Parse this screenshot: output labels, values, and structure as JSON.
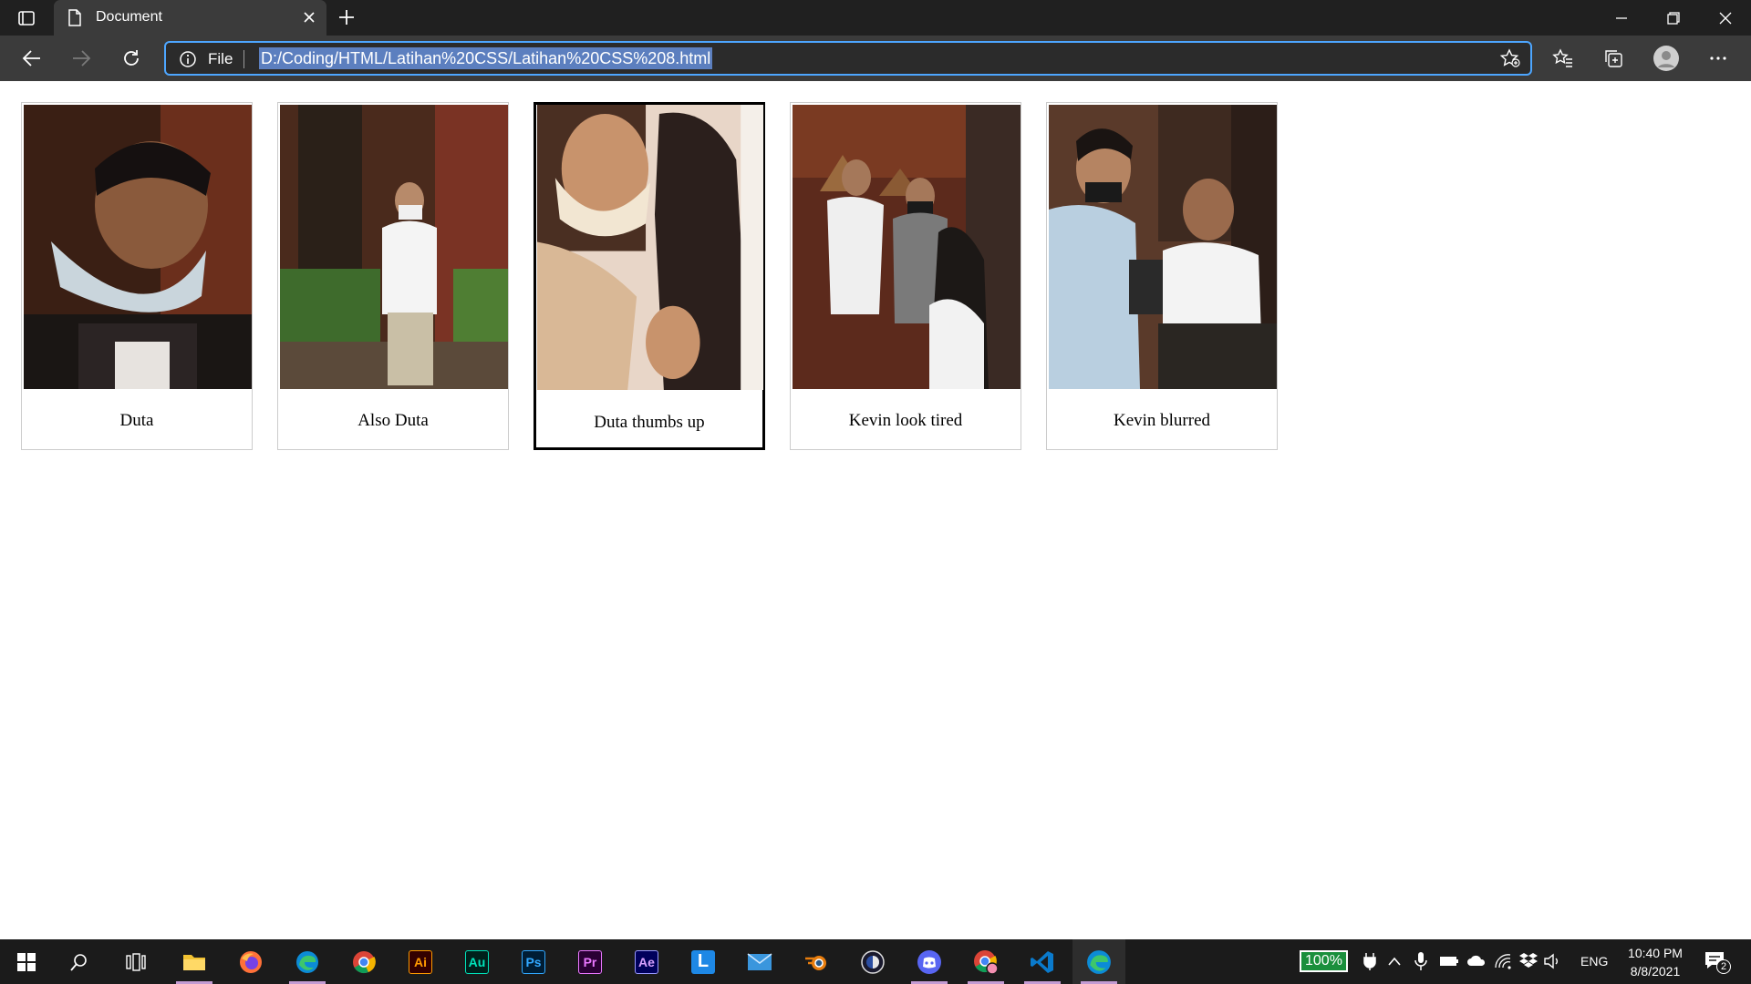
{
  "browser": {
    "tab_title": "Document",
    "address_scheme": "File",
    "address_url": "D:/Coding/HTML/Latihan%20CSS/Latihan%20CSS%208.html"
  },
  "gallery": {
    "cards": [
      {
        "caption": "Duta",
        "active": false
      },
      {
        "caption": "Also Duta",
        "active": false
      },
      {
        "caption": "Duta thumbs up",
        "active": true
      },
      {
        "caption": "Kevin look tired",
        "active": false
      },
      {
        "caption": "Kevin blurred",
        "active": false
      }
    ]
  },
  "taskbar": {
    "apps": [
      "start",
      "search",
      "task-view",
      "file-explorer",
      "firefox",
      "edge",
      "chrome",
      "illustrator",
      "audition",
      "photoshop",
      "premiere",
      "after-effects",
      "l-app",
      "mail",
      "blender",
      "cinema4d",
      "discord",
      "chrome-profile",
      "vscode",
      "edge-active"
    ],
    "app_labels": {
      "illustrator": "Ai",
      "audition": "Au",
      "photoshop": "Ps",
      "premiere": "Pr",
      "after_effects": "Ae",
      "l_app": "L"
    },
    "battery": "100%",
    "language": "ENG",
    "time": "10:40 PM",
    "date": "8/8/2021",
    "notification_count": "2"
  }
}
